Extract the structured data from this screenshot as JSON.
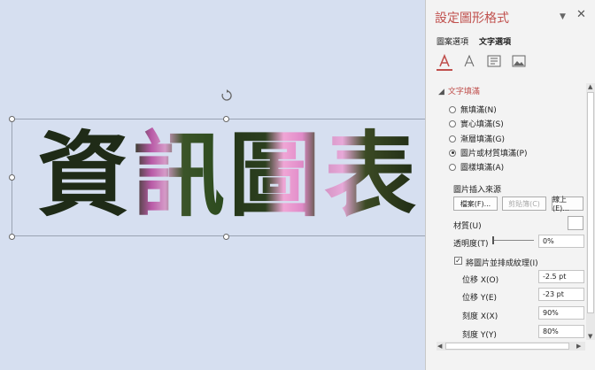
{
  "slide": {
    "glyphs": [
      "資",
      "訊",
      "圖",
      "表"
    ]
  },
  "pane": {
    "title": "設定圖形格式",
    "close": "✕",
    "caret": "▼",
    "tabs": [
      "圖案選項",
      "文字選項"
    ],
    "icons": [
      "text-fill-icon",
      "text-outline-icon",
      "text-box-icon",
      "picture-icon"
    ],
    "section_title": "文字填滿",
    "fill_options": [
      "無填滿(N)",
      "實心填滿(S)",
      "漸層填滿(G)",
      "圖片或材質填滿(P)",
      "圖樣填滿(A)"
    ],
    "selected_fill_index": 3,
    "picture_source_label": "圖片插入來源",
    "file_button": "檔案(F)...",
    "clipboard_button": "剪貼簿(C)",
    "online_button": "線上(E)...",
    "texture_label": "材質(U)",
    "transparency_label": "透明度(T)",
    "transparency_value": "0%",
    "tile_checkbox_label": "將圖片並排成紋理(I)",
    "tile_checked": true,
    "offset_x_label": "位移 X(O)",
    "offset_x_value": "-2.5 pt",
    "offset_y_label": "位移 Y(E)",
    "offset_y_value": "-23 pt",
    "scale_x_label": "刻度 X(X)",
    "scale_x_value": "90%",
    "scale_y_label": "刻度 Y(Y)",
    "scale_y_value": "80%"
  },
  "colors": {
    "accent": "#c0504d",
    "slide_bg": "#d6dff0"
  }
}
